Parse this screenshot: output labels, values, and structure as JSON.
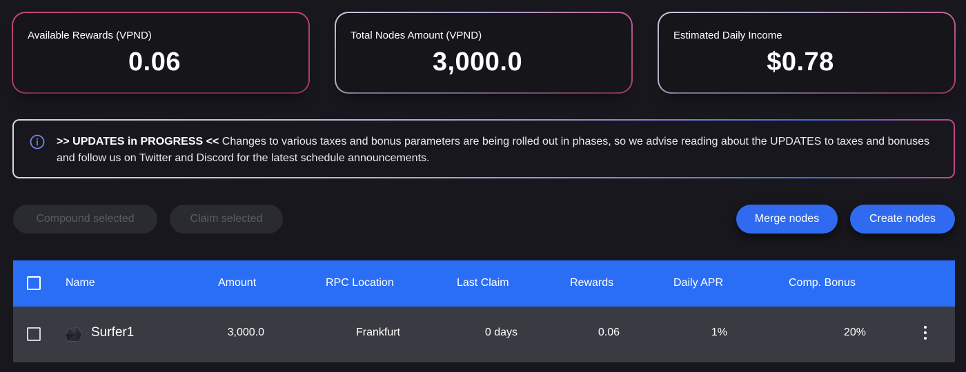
{
  "stats": {
    "available_rewards": {
      "label": "Available Rewards (VPND)",
      "value": "0.06"
    },
    "total_nodes": {
      "label": "Total Nodes Amount (VPND)",
      "value": "3,000.0"
    },
    "daily_income": {
      "label": "Estimated Daily Income",
      "value": "$0.78"
    }
  },
  "banner": {
    "icon": "info-icon",
    "heading": ">> UPDATES in PROGRESS <<",
    "text": " Changes to various taxes and bonus parameters are being rolled out in phases, so we advise reading about the UPDATES to taxes and bonuses and follow us on Twitter and Discord for the latest schedule announcements."
  },
  "actions": {
    "compound_selected": "Compound selected",
    "claim_selected": "Claim selected",
    "merge_nodes": "Merge nodes",
    "create_nodes": "Create nodes"
  },
  "table": {
    "headers": {
      "name": "Name",
      "amount": "Amount",
      "rpc_location": "RPC Location",
      "last_claim": "Last Claim",
      "rewards": "Rewards",
      "daily_apr": "Daily APR",
      "comp_bonus": "Comp. Bonus"
    },
    "rows": [
      {
        "name": "Surfer1",
        "amount": "3,000.0",
        "rpc_location": "Frankfurt",
        "last_claim": "0 days",
        "rewards": "0.06",
        "daily_apr": "1%",
        "comp_bonus": "20%"
      }
    ]
  },
  "colors": {
    "background": "#17171d",
    "accent_blue": "#2f6af0",
    "card_border_pink": "#c2457e",
    "row_background": "#393a42",
    "disabled_button": "#2a2b30"
  }
}
